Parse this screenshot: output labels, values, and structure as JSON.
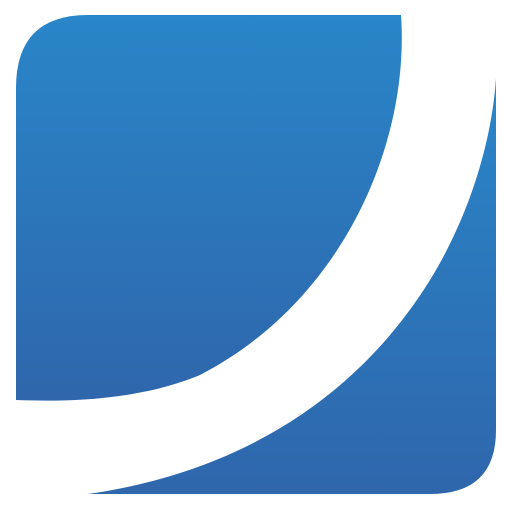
{
  "logo": {
    "icon_name": "blue-square-swoosh-logo-icon",
    "colors": {
      "background": "#ffffff",
      "gradient_top": "#2986c8",
      "gradient_bottom": "#2f66ac",
      "swoosh": "#ffffff"
    }
  }
}
